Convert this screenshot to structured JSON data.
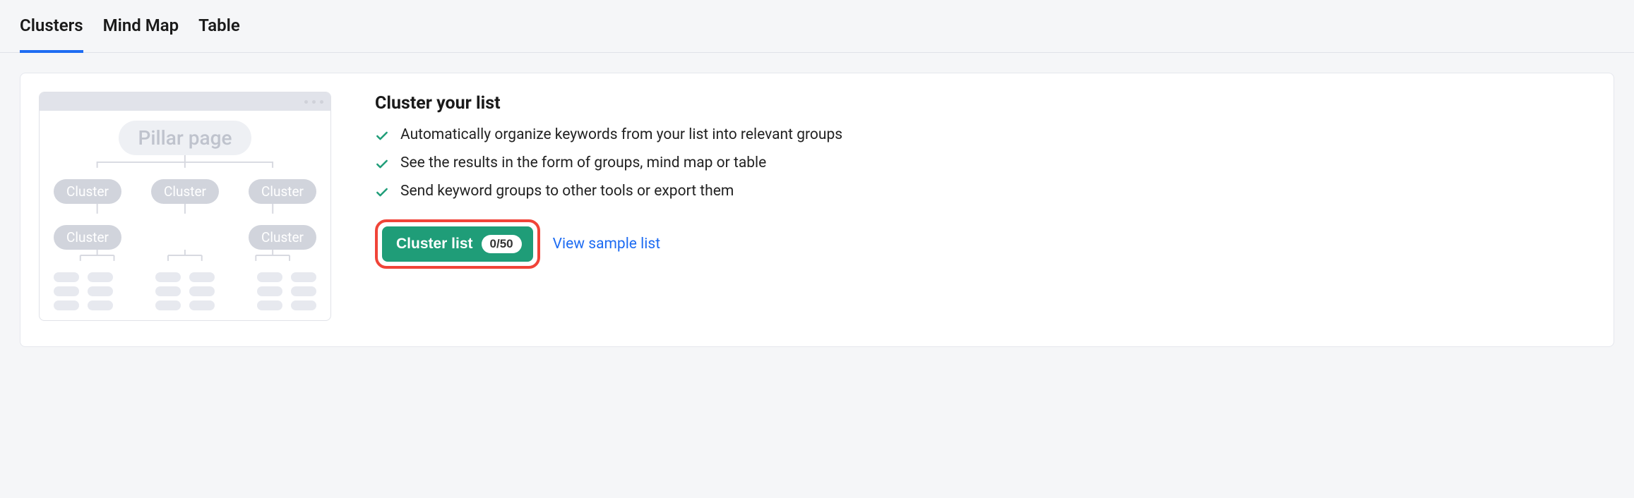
{
  "tabs": [
    {
      "label": "Clusters",
      "active": true
    },
    {
      "label": "Mind Map",
      "active": false
    },
    {
      "label": "Table",
      "active": false
    }
  ],
  "illustration": {
    "pillar_label": "Pillar page",
    "cluster_label": "Cluster"
  },
  "content": {
    "title": "Cluster your list",
    "bullets": [
      "Automatically organize keywords from your list into relevant groups",
      "See the results in the form of groups, mind map or table",
      "Send keyword groups to other tools or export them"
    ],
    "cluster_button_label": "Cluster list",
    "cluster_button_badge": "0/50",
    "sample_link_label": "View sample list"
  }
}
